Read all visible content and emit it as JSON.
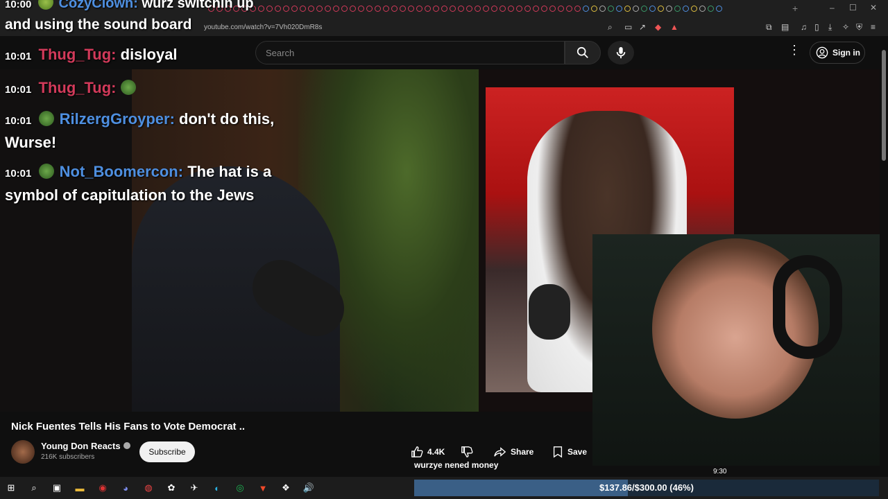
{
  "browser": {
    "url": "youtube.com/watch?v=7Vh020DmR8s",
    "window_controls": [
      "–",
      "☐",
      "✕"
    ],
    "new_tab": "+"
  },
  "youtube": {
    "search_placeholder": "Search",
    "sign_in": "Sign in"
  },
  "overlay": {
    "top_message": {
      "time": "10:00",
      "user": "CozyClown",
      "text": "wurz switchin up and using the sound board"
    },
    "chat": [
      {
        "time": "10:01",
        "user": "Thug_Tug",
        "text": "disloyal",
        "color": "#d23a5a"
      },
      {
        "time": "10:01",
        "user": "Thug_Tug",
        "text": "",
        "color": "#d23a5a"
      },
      {
        "time": "10:01",
        "user": "RilzergGroyper",
        "text": "don't do this,",
        "text2": "Wurse!",
        "color": "#4e8fe0"
      },
      {
        "time": "10:01",
        "user": "Not_Boomercon",
        "text": "The hat is a",
        "text2": "symbol of capitulation to the Jews",
        "color": "#4e8fe0"
      }
    ],
    "donation_message": "wurzye nened money",
    "streamer_timestamp": "9:30",
    "goal": {
      "text": "$137.86/$300.00 (46%)",
      "fraction": 0.46
    }
  },
  "video": {
    "title": "Nick Fuentes Tells His Fans to Vote Democrat ..",
    "channel": "Young Don Reacts",
    "subscribers": "216K subscribers",
    "subscribe_label": "Subscribe",
    "likes": "4.4K",
    "share_label": "Share",
    "save_label": "Save"
  },
  "taskbar": {
    "icons": [
      "windows-start-icon",
      "search-icon",
      "task-view-icon",
      "file-explorer-icon",
      "obs-icon",
      "discord-icon",
      "chrome-icon",
      "app-icon",
      "steam-icon",
      "edge-icon",
      "spotify-icon",
      "brave-icon",
      "app2-icon",
      "volume-icon"
    ]
  },
  "colors": {
    "accent_red": "#d23a5a",
    "accent_blue": "#4e8fe0",
    "goal_fill": "#3a5f86"
  }
}
